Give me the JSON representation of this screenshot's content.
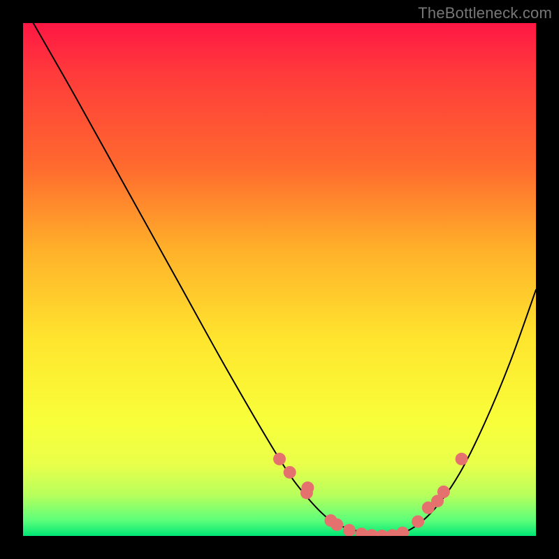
{
  "watermark": "TheBottleneck.com",
  "chart_data": {
    "type": "line",
    "title": "",
    "xlabel": "",
    "ylabel": "",
    "xlim": [
      0,
      1
    ],
    "ylim": [
      0,
      1
    ],
    "grid": false,
    "legend": false,
    "series": [
      {
        "name": "curve",
        "color": "#000000",
        "x": [
          0.02,
          0.1,
          0.2,
          0.3,
          0.4,
          0.5,
          0.55,
          0.6,
          0.65,
          0.7,
          0.75,
          0.8,
          0.85,
          0.9,
          0.95,
          1.0
        ],
        "y": [
          1.0,
          0.86,
          0.68,
          0.5,
          0.32,
          0.15,
          0.08,
          0.03,
          0.01,
          0.0,
          0.01,
          0.05,
          0.12,
          0.22,
          0.34,
          0.48
        ]
      }
    ],
    "markers": [
      {
        "name": "dots",
        "color": "#e5716f",
        "radius": 9,
        "x": [
          0.5,
          0.52,
          0.553,
          0.555,
          0.6,
          0.612,
          0.636,
          0.66,
          0.68,
          0.7,
          0.72,
          0.74,
          0.77,
          0.79,
          0.808,
          0.82,
          0.855
        ],
        "y": [
          0.15,
          0.124,
          0.084,
          0.094,
          0.03,
          0.022,
          0.011,
          0.004,
          0.001,
          0.0,
          0.001,
          0.006,
          0.028,
          0.055,
          0.068,
          0.086,
          0.15
        ]
      }
    ]
  }
}
